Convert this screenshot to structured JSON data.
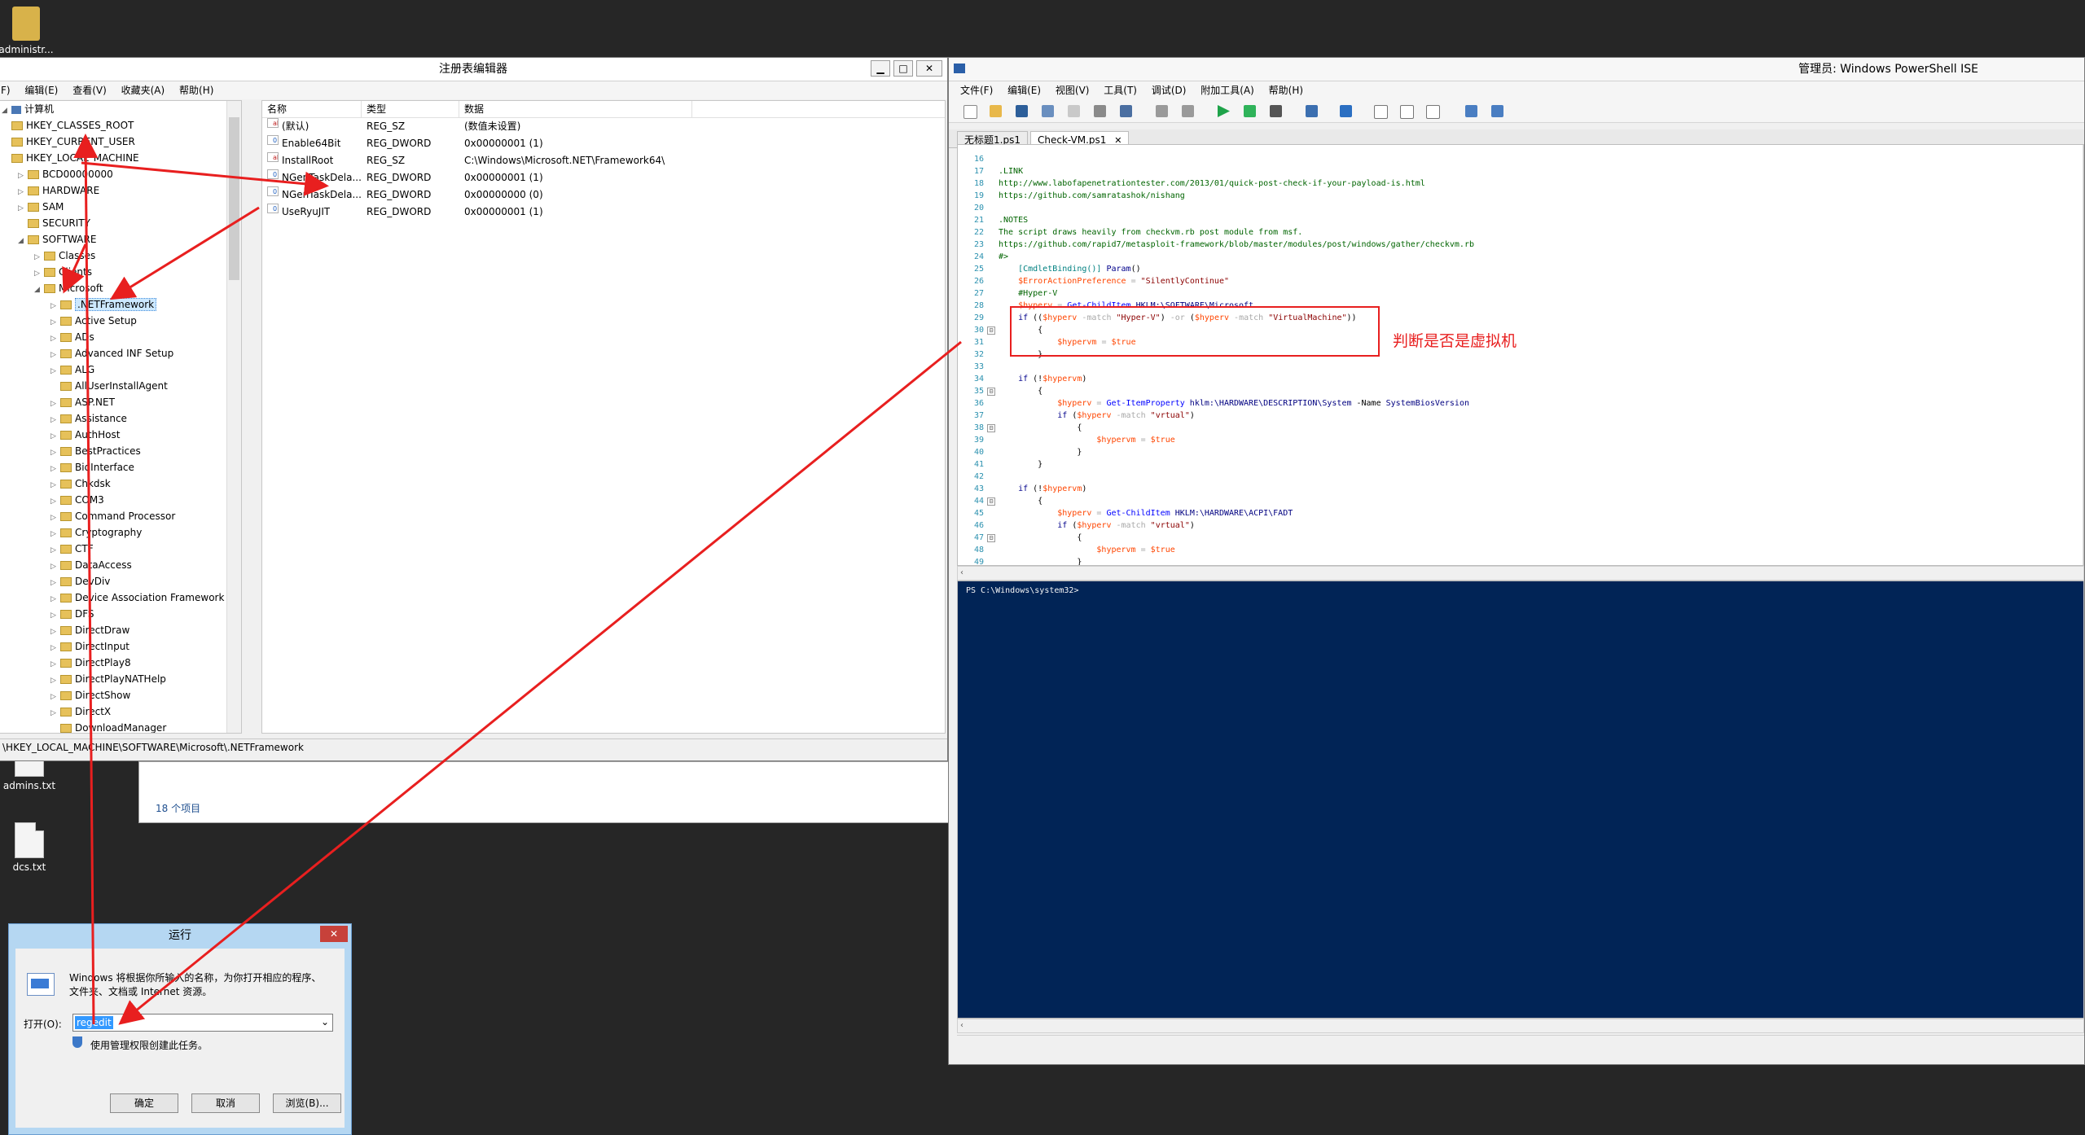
{
  "desktop": {
    "icons": [
      {
        "label": "administr...",
        "icon": "user-folder-icon"
      },
      {
        "label": "admins.txt",
        "icon": "text-file-icon"
      },
      {
        "label": "dcs.txt",
        "icon": "text-file-icon"
      }
    ]
  },
  "regedit": {
    "title": "注册表编辑器",
    "controls": {
      "minimize": "▁",
      "maximize": "□",
      "close": "✕"
    },
    "menu": [
      "F)",
      "编辑(E)",
      "查看(V)",
      "收藏夹(A)",
      "帮助(H)"
    ],
    "tree_root": "计算机",
    "tree": [
      {
        "label": "HKEY_CLASSES_ROOT",
        "arrow": "",
        "level": 0
      },
      {
        "label": "HKEY_CURRENT_USER",
        "arrow": "",
        "level": 0
      },
      {
        "label": "HKEY_LOCAL_MACHINE",
        "arrow": "",
        "level": 0
      },
      {
        "label": "BCD00000000",
        "arrow": "▷",
        "level": 1
      },
      {
        "label": "HARDWARE",
        "arrow": "▷",
        "level": 1
      },
      {
        "label": "SAM",
        "arrow": "▷",
        "level": 1
      },
      {
        "label": "SECURITY",
        "arrow": "",
        "level": 1
      },
      {
        "label": "SOFTWARE",
        "arrow": "◢",
        "level": 1
      },
      {
        "label": "Classes",
        "arrow": "▷",
        "level": 2
      },
      {
        "label": "Clients",
        "arrow": "▷",
        "level": 2
      },
      {
        "label": "Microsoft",
        "arrow": "◢",
        "level": 2
      },
      {
        "label": ".NETFramework",
        "arrow": "▷",
        "level": 3,
        "selected": true
      },
      {
        "label": "Active Setup",
        "arrow": "▷",
        "level": 3
      },
      {
        "label": "ADs",
        "arrow": "▷",
        "level": 3
      },
      {
        "label": "Advanced INF Setup",
        "arrow": "▷",
        "level": 3
      },
      {
        "label": "ALG",
        "arrow": "▷",
        "level": 3
      },
      {
        "label": "AllUserInstallAgent",
        "arrow": "",
        "level": 3
      },
      {
        "label": "ASP.NET",
        "arrow": "▷",
        "level": 3
      },
      {
        "label": "Assistance",
        "arrow": "▷",
        "level": 3
      },
      {
        "label": "AuthHost",
        "arrow": "▷",
        "level": 3
      },
      {
        "label": "BestPractices",
        "arrow": "▷",
        "level": 3
      },
      {
        "label": "BidInterface",
        "arrow": "▷",
        "level": 3
      },
      {
        "label": "Chkdsk",
        "arrow": "▷",
        "level": 3
      },
      {
        "label": "COM3",
        "arrow": "▷",
        "level": 3
      },
      {
        "label": "Command Processor",
        "arrow": "▷",
        "level": 3
      },
      {
        "label": "Cryptography",
        "arrow": "▷",
        "level": 3
      },
      {
        "label": "CTF",
        "arrow": "▷",
        "level": 3
      },
      {
        "label": "DataAccess",
        "arrow": "▷",
        "level": 3
      },
      {
        "label": "DevDiv",
        "arrow": "▷",
        "level": 3
      },
      {
        "label": "Device Association Framework",
        "arrow": "▷",
        "level": 3
      },
      {
        "label": "DFS",
        "arrow": "▷",
        "level": 3
      },
      {
        "label": "DirectDraw",
        "arrow": "▷",
        "level": 3
      },
      {
        "label": "DirectInput",
        "arrow": "▷",
        "level": 3
      },
      {
        "label": "DirectPlay8",
        "arrow": "▷",
        "level": 3
      },
      {
        "label": "DirectPlayNATHelp",
        "arrow": "▷",
        "level": 3
      },
      {
        "label": "DirectShow",
        "arrow": "▷",
        "level": 3
      },
      {
        "label": "DirectX",
        "arrow": "▷",
        "level": 3
      },
      {
        "label": "DownloadManager",
        "arrow": "",
        "level": 3
      }
    ],
    "columns": [
      "名称",
      "类型",
      "数据"
    ],
    "values": [
      {
        "name": "(默认)",
        "type": "REG_SZ",
        "data": "(数值未设置)",
        "icon": "ab"
      },
      {
        "name": "Enable64Bit",
        "type": "REG_DWORD",
        "data": "0x00000001 (1)",
        "icon": "01"
      },
      {
        "name": "InstallRoot",
        "type": "REG_SZ",
        "data": "C:\\Windows\\Microsoft.NET\\Framework64\\",
        "icon": "ab"
      },
      {
        "name": "NGenTaskDela...",
        "type": "REG_DWORD",
        "data": "0x00000001 (1)",
        "icon": "01"
      },
      {
        "name": "NGenTaskDela...",
        "type": "REG_DWORD",
        "data": "0x00000000 (0)",
        "icon": "01"
      },
      {
        "name": "UseRyuJIT",
        "type": "REG_DWORD",
        "data": "0x00000001 (1)",
        "icon": "01"
      }
    ],
    "status_path": "\\HKEY_LOCAL_MACHINE\\SOFTWARE\\Microsoft\\.NETFramework"
  },
  "explorer": {
    "item_count": "18 个项目"
  },
  "ise": {
    "title": "管理员: Windows PowerShell ISE",
    "menu": [
      "文件(F)",
      "编辑(E)",
      "视图(V)",
      "工具(T)",
      "调试(D)",
      "附加工具(A)",
      "帮助(H)"
    ],
    "tabs": [
      {
        "label": "无标题1.ps1",
        "active": false
      },
      {
        "label": "Check-VM.ps1",
        "active": true,
        "close": "✕"
      }
    ],
    "code_lines": [
      {
        "n": "16",
        "fold": "",
        "parts": []
      },
      {
        "n": "17",
        "fold": "",
        "parts": [
          {
            "c": "c-comment",
            "t": ".LINK"
          }
        ]
      },
      {
        "n": "18",
        "fold": "",
        "parts": [
          {
            "c": "c-comment",
            "t": "http://www.labofapenetrationtester.com/2013/01/quick-post-check-if-your-payload-is.html"
          }
        ]
      },
      {
        "n": "19",
        "fold": "",
        "parts": [
          {
            "c": "c-comment",
            "t": "https://github.com/samratashok/nishang"
          }
        ]
      },
      {
        "n": "20",
        "fold": "",
        "parts": []
      },
      {
        "n": "21",
        "fold": "",
        "parts": [
          {
            "c": "c-comment",
            "t": ".NOTES"
          }
        ]
      },
      {
        "n": "22",
        "fold": "",
        "parts": [
          {
            "c": "c-comment",
            "t": "The script draws heavily from checkvm.rb post module from msf."
          }
        ]
      },
      {
        "n": "23",
        "fold": "",
        "parts": [
          {
            "c": "c-comment",
            "t": "https://github.com/rapid7/metasploit-framework/blob/master/modules/post/windows/gather/checkvm.rb"
          }
        ]
      },
      {
        "n": "24",
        "fold": "",
        "parts": [
          {
            "c": "c-comment",
            "t": "#>"
          }
        ]
      },
      {
        "n": "25",
        "fold": "",
        "parts": [
          {
            "c": "c-type",
            "t": "    [CmdletBinding()]"
          },
          {
            "c": "c-plain",
            "t": " "
          },
          {
            "c": "c-kw",
            "t": "Param"
          },
          {
            "c": "c-plain",
            "t": "()"
          }
        ]
      },
      {
        "n": "26",
        "fold": "",
        "parts": [
          {
            "c": "c-var",
            "t": "    $ErrorActionPreference"
          },
          {
            "c": "c-op",
            "t": " = "
          },
          {
            "c": "c-str",
            "t": "\"SilentlyContinue\""
          }
        ]
      },
      {
        "n": "27",
        "fold": "",
        "parts": [
          {
            "c": "c-comment",
            "t": "    #Hyper-V"
          }
        ]
      },
      {
        "n": "28",
        "fold": "",
        "parts": [
          {
            "c": "c-var",
            "t": "    $hyperv"
          },
          {
            "c": "c-op",
            "t": " = "
          },
          {
            "c": "c-cmd",
            "t": "Get-ChildItem"
          },
          {
            "c": "c-param",
            "t": " HKLM:\\SOFTWARE\\Microsoft"
          }
        ]
      },
      {
        "n": "29",
        "fold": "",
        "parts": [
          {
            "c": "c-kw",
            "t": "    if"
          },
          {
            "c": "c-plain",
            "t": " (("
          },
          {
            "c": "c-var",
            "t": "$hyperv"
          },
          {
            "c": "c-op",
            "t": " -match "
          },
          {
            "c": "c-str",
            "t": "\"Hyper-V\""
          },
          {
            "c": "c-plain",
            "t": ")"
          },
          {
            "c": "c-op",
            "t": " -or "
          },
          {
            "c": "c-plain",
            "t": "("
          },
          {
            "c": "c-var",
            "t": "$hyperv"
          },
          {
            "c": "c-op",
            "t": " -match "
          },
          {
            "c": "c-str",
            "t": "\"VirtualMachine\""
          },
          {
            "c": "c-plain",
            "t": "))"
          }
        ]
      },
      {
        "n": "30",
        "fold": "⊟",
        "parts": [
          {
            "c": "c-plain",
            "t": "        {"
          }
        ]
      },
      {
        "n": "31",
        "fold": "",
        "parts": [
          {
            "c": "c-var",
            "t": "            $hypervm"
          },
          {
            "c": "c-op",
            "t": " = "
          },
          {
            "c": "c-var",
            "t": "$true"
          }
        ]
      },
      {
        "n": "32",
        "fold": "",
        "parts": [
          {
            "c": "c-plain",
            "t": "        }"
          }
        ]
      },
      {
        "n": "33",
        "fold": "",
        "parts": []
      },
      {
        "n": "34",
        "fold": "",
        "parts": [
          {
            "c": "c-kw",
            "t": "    if"
          },
          {
            "c": "c-plain",
            "t": " (!"
          },
          {
            "c": "c-var",
            "t": "$hypervm"
          },
          {
            "c": "c-plain",
            "t": ")"
          }
        ]
      },
      {
        "n": "35",
        "fold": "⊟",
        "parts": [
          {
            "c": "c-plain",
            "t": "        {"
          }
        ]
      },
      {
        "n": "36",
        "fold": "",
        "parts": [
          {
            "c": "c-var",
            "t": "            $hyperv"
          },
          {
            "c": "c-op",
            "t": " = "
          },
          {
            "c": "c-cmd",
            "t": "Get-ItemProperty"
          },
          {
            "c": "c-param",
            "t": " hklm:\\HARDWARE\\DESCRIPTION\\System "
          },
          {
            "c": "c-plain",
            "t": "-Name"
          },
          {
            "c": "c-param",
            "t": " SystemBiosVersion"
          }
        ]
      },
      {
        "n": "37",
        "fold": "",
        "parts": [
          {
            "c": "c-kw",
            "t": "            if"
          },
          {
            "c": "c-plain",
            "t": " ("
          },
          {
            "c": "c-var",
            "t": "$hyperv"
          },
          {
            "c": "c-op",
            "t": " -match "
          },
          {
            "c": "c-str",
            "t": "\"vrtual\""
          },
          {
            "c": "c-plain",
            "t": ")"
          }
        ]
      },
      {
        "n": "38",
        "fold": "⊟",
        "parts": [
          {
            "c": "c-plain",
            "t": "                {"
          }
        ]
      },
      {
        "n": "39",
        "fold": "",
        "parts": [
          {
            "c": "c-var",
            "t": "                    $hypervm"
          },
          {
            "c": "c-op",
            "t": " = "
          },
          {
            "c": "c-var",
            "t": "$true"
          }
        ]
      },
      {
        "n": "40",
        "fold": "",
        "parts": [
          {
            "c": "c-plain",
            "t": "                }"
          }
        ]
      },
      {
        "n": "41",
        "fold": "",
        "parts": [
          {
            "c": "c-plain",
            "t": "        }"
          }
        ]
      },
      {
        "n": "42",
        "fold": "",
        "parts": []
      },
      {
        "n": "43",
        "fold": "",
        "parts": [
          {
            "c": "c-kw",
            "t": "    if"
          },
          {
            "c": "c-plain",
            "t": " (!"
          },
          {
            "c": "c-var",
            "t": "$hypervm"
          },
          {
            "c": "c-plain",
            "t": ")"
          }
        ]
      },
      {
        "n": "44",
        "fold": "⊟",
        "parts": [
          {
            "c": "c-plain",
            "t": "        {"
          }
        ]
      },
      {
        "n": "45",
        "fold": "",
        "parts": [
          {
            "c": "c-var",
            "t": "            $hyperv"
          },
          {
            "c": "c-op",
            "t": " = "
          },
          {
            "c": "c-cmd",
            "t": "Get-ChildItem"
          },
          {
            "c": "c-param",
            "t": " HKLM:\\HARDWARE\\ACPI\\FADT"
          }
        ]
      },
      {
        "n": "46",
        "fold": "",
        "parts": [
          {
            "c": "c-kw",
            "t": "            if"
          },
          {
            "c": "c-plain",
            "t": " ("
          },
          {
            "c": "c-var",
            "t": "$hyperv"
          },
          {
            "c": "c-op",
            "t": " -match "
          },
          {
            "c": "c-str",
            "t": "\"vrtual\""
          },
          {
            "c": "c-plain",
            "t": ")"
          }
        ]
      },
      {
        "n": "47",
        "fold": "⊟",
        "parts": [
          {
            "c": "c-plain",
            "t": "                {"
          }
        ]
      },
      {
        "n": "48",
        "fold": "",
        "parts": [
          {
            "c": "c-var",
            "t": "                    $hypervm"
          },
          {
            "c": "c-op",
            "t": " = "
          },
          {
            "c": "c-var",
            "t": "$true"
          }
        ]
      },
      {
        "n": "49",
        "fold": "",
        "parts": [
          {
            "c": "c-plain",
            "t": "                }"
          }
        ]
      }
    ],
    "console_prompt": "PS C:\\Windows\\system32>",
    "annotation": "判断是否是虚拟机"
  },
  "run_dialog": {
    "title": "运行",
    "close": "✕",
    "description_line1": "Windows 将根据你所输入的名称，为你打开相应的程序、",
    "description_line2": "文件夹、文档或 Internet 资源。",
    "open_label": "打开(O):",
    "input_value": "regedit",
    "dropdown_arrow": "⌄",
    "admin_note": "使用管理权限创建此任务。",
    "ok": "确定",
    "cancel": "取消",
    "browse": "浏览(B)..."
  },
  "colors": {
    "annotation": "#e81f1f",
    "console_bg": "#012456",
    "desktop_bg": "#262626"
  }
}
